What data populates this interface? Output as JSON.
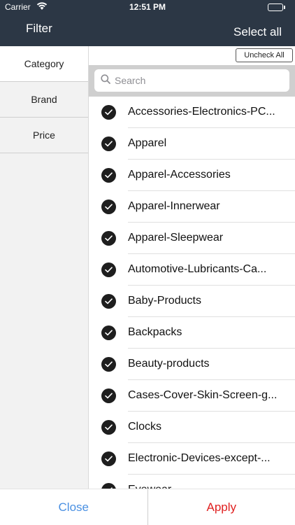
{
  "status": {
    "carrier": "Carrier",
    "time": "12:51 PM",
    "battery_level": 1.0
  },
  "nav": {
    "title": "Filter",
    "select_all": "Select all"
  },
  "sidebar": {
    "items": [
      {
        "label": "Category",
        "active": true
      },
      {
        "label": "Brand",
        "active": false
      },
      {
        "label": "Price",
        "active": false
      }
    ]
  },
  "content": {
    "uncheck_all": "Uncheck All",
    "search_placeholder": "Search",
    "items": [
      {
        "label": "Accessories-Electronics-PC...",
        "checked": true
      },
      {
        "label": "Apparel",
        "checked": true
      },
      {
        "label": "Apparel-Accessories",
        "checked": true
      },
      {
        "label": "Apparel-Innerwear",
        "checked": true
      },
      {
        "label": "Apparel-Sleepwear",
        "checked": true
      },
      {
        "label": "Automotive-Lubricants-Ca...",
        "checked": true
      },
      {
        "label": "Baby-Products",
        "checked": true
      },
      {
        "label": "Backpacks",
        "checked": true
      },
      {
        "label": "Beauty-products",
        "checked": true
      },
      {
        "label": "Cases-Cover-Skin-Screen-g...",
        "checked": true
      },
      {
        "label": "Clocks",
        "checked": true
      },
      {
        "label": "Electronic-Devices-except-...",
        "checked": true
      },
      {
        "label": "Eyewear",
        "checked": true
      }
    ]
  },
  "bottom": {
    "close": "Close",
    "apply": "Apply"
  },
  "colors": {
    "nav_bg": "#2c3745",
    "close": "#4a90e2",
    "apply": "#e02020",
    "check": "#1e1e1e"
  }
}
